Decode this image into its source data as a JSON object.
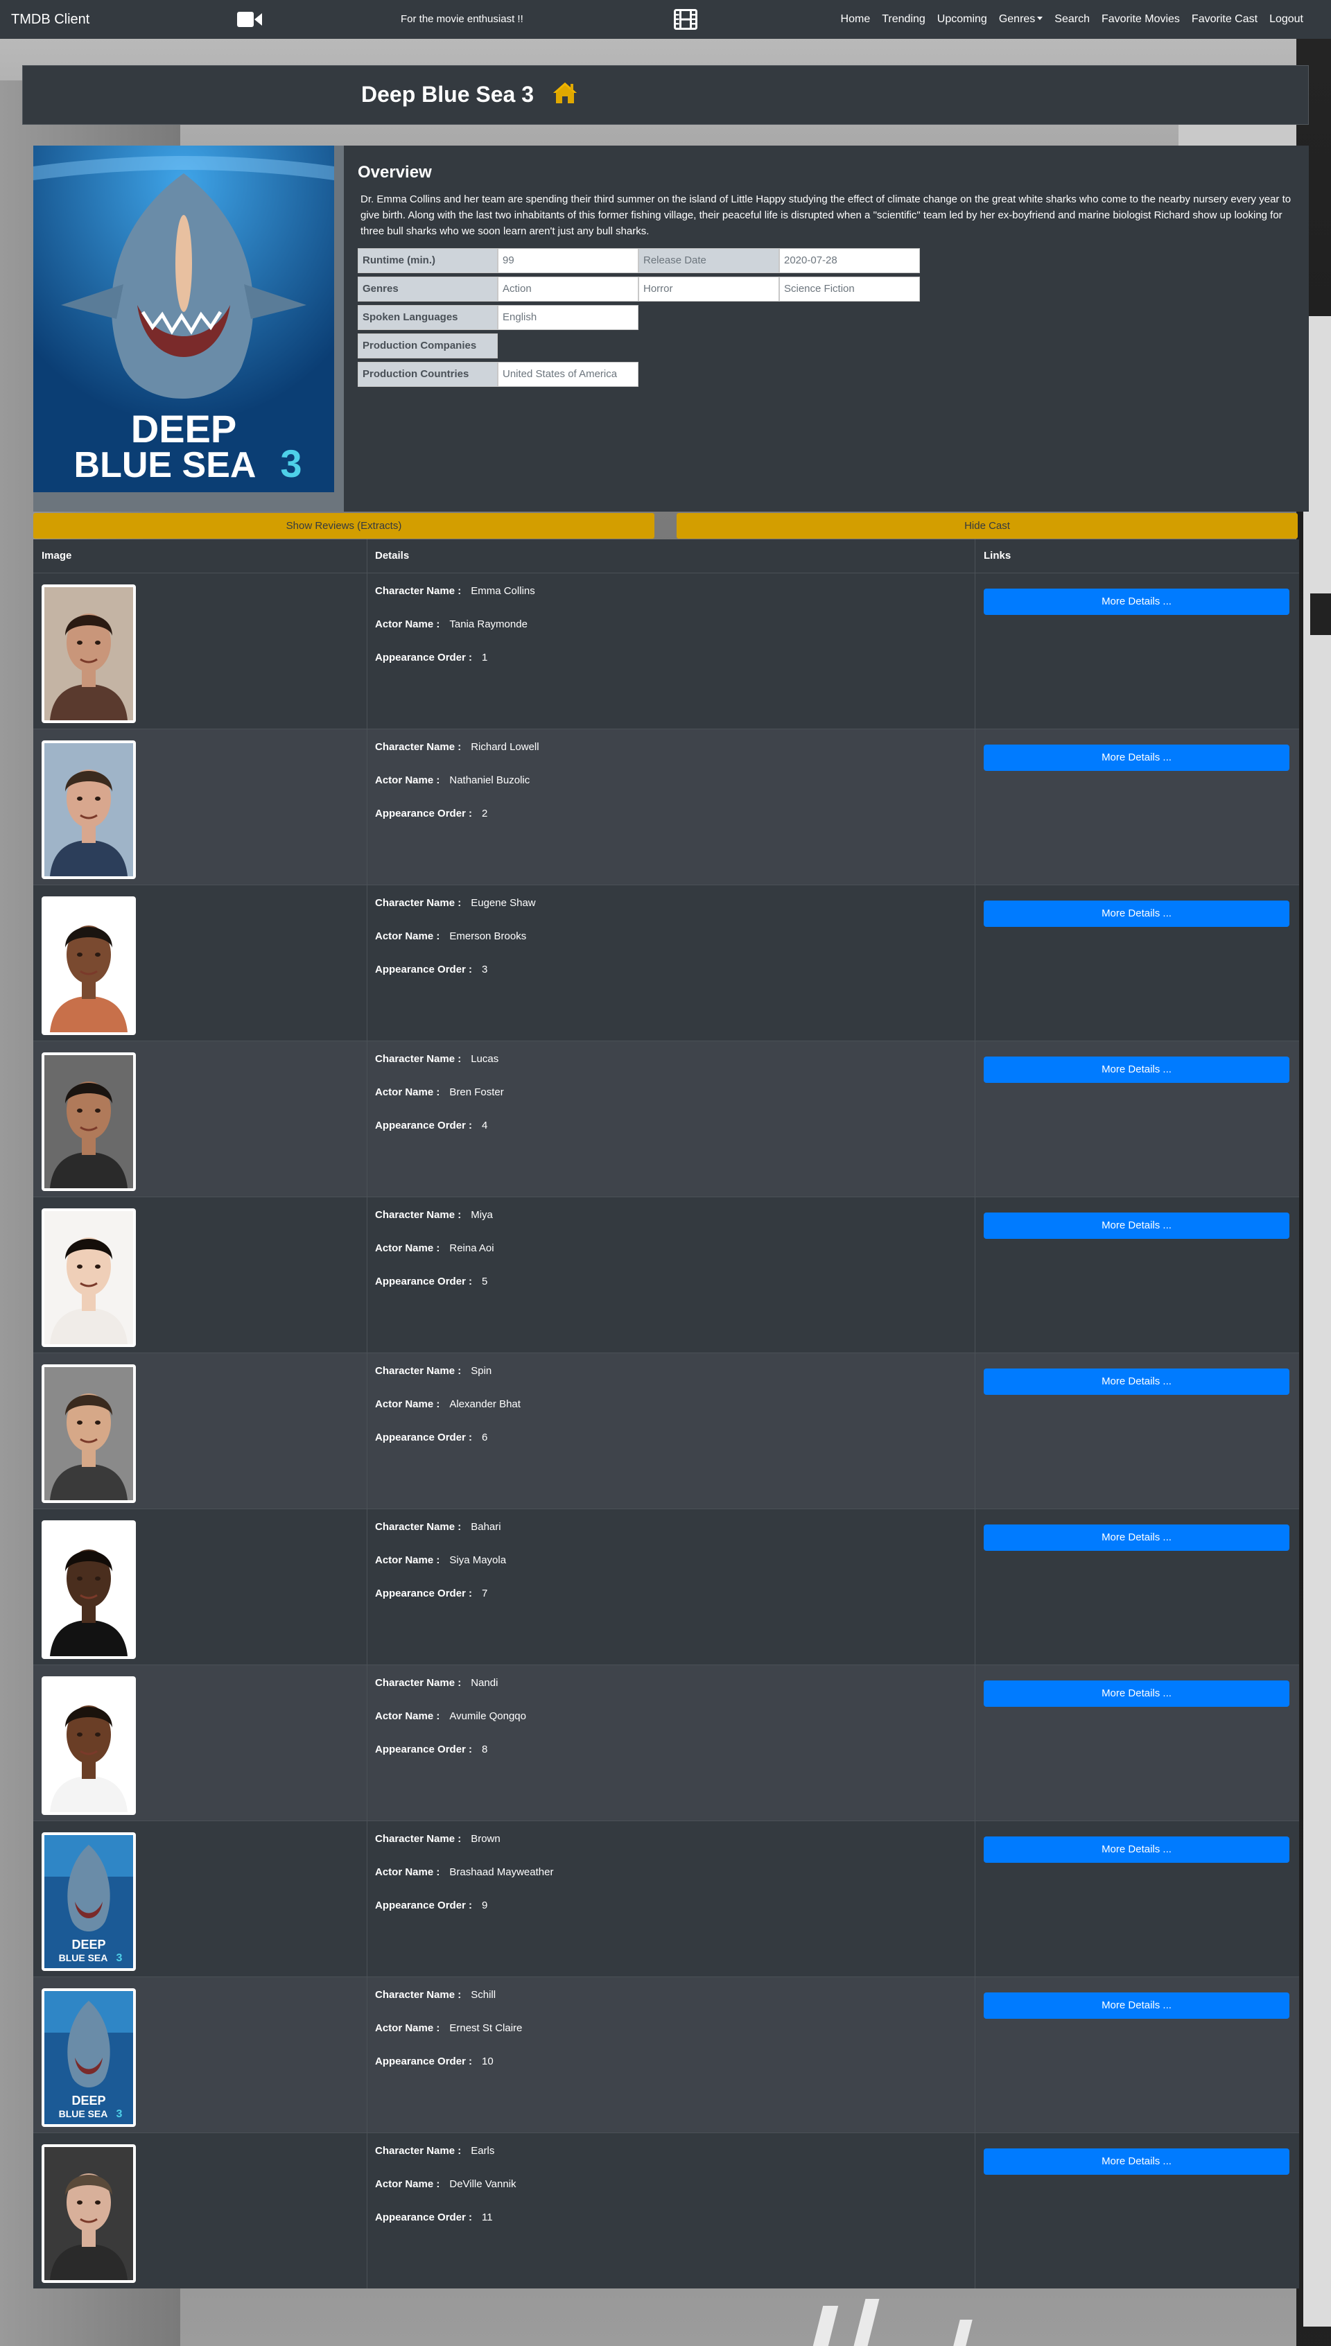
{
  "navbar": {
    "brand": "TMDB Client",
    "tagline": "For the movie enthusiast !!",
    "camera_icon": "video-camera-icon",
    "film_icon": "film-icon",
    "links": [
      "Home",
      "Trending",
      "Upcoming",
      "Genres",
      "Search",
      "Favorite Movies",
      "Favorite Cast",
      "Logout"
    ]
  },
  "movie": {
    "title": "Deep Blue Sea 3",
    "home_icon": "home-icon",
    "poster_text_line1": "DEEP",
    "poster_text_line2": "BLUE SEA",
    "poster_text_num": "3",
    "overview_heading": "Overview",
    "overview": "Dr. Emma Collins and her team are spending their third summer on the island of Little Happy studying the effect of climate change on the great white sharks who come to the nearby nursery every year to give birth. Along with the last two inhabitants of this former fishing village, their peaceful life is disrupted when a \"scientific\" team led by her ex-boyfriend and marine biologist Richard show up looking for three bull sharks who we soon learn aren't just any bull sharks.",
    "runtime_label": "Runtime (min.)",
    "runtime": "99",
    "release_label": "Release Date",
    "release_date": "2020-07-28",
    "genres_label": "Genres",
    "genres": [
      "Action",
      "Horror",
      "Science Fiction"
    ],
    "languages_label": "Spoken Languages",
    "languages": "English",
    "companies_label": "Production Companies",
    "countries_label": "Production Countries",
    "countries": "United States of America"
  },
  "buttons": {
    "show_reviews": "Show Reviews (Extracts)",
    "hide_cast": "Hide Cast",
    "more_details": "More Details ..."
  },
  "cast_table": {
    "headers": [
      "Image",
      "Details",
      "Links"
    ],
    "character_label": "Character Name :",
    "actor_label": "Actor Name :",
    "order_label": "Appearance Order :",
    "rows": [
      {
        "character": "Emma Collins",
        "actor": "Tania Raymonde",
        "order": "1",
        "photo": "woman-dark-hair",
        "skin": "#c9967a",
        "hair": "#2a1a12",
        "shirt": "#5a3a2e",
        "bg": "#c4b4a4"
      },
      {
        "character": "Richard Lowell",
        "actor": "Nathaniel Buzolic",
        "order": "2",
        "photo": "man-smiling",
        "skin": "#d8a78e",
        "hair": "#3a2a1e",
        "shirt": "#2c3e5a",
        "bg": "#9fb4c8"
      },
      {
        "character": "Eugene Shaw",
        "actor": "Emerson Brooks",
        "order": "3",
        "photo": "man-plaid-shirt",
        "skin": "#7a4a30",
        "hair": "#1a1410",
        "shirt": "#c8704a",
        "bg": "#ffffff"
      },
      {
        "character": "Lucas",
        "actor": "Bren Foster",
        "order": "4",
        "photo": "man-stubble",
        "skin": "#b07a5a",
        "hair": "#1a1410",
        "shirt": "#2a2a2a",
        "bg": "#6a6a6a"
      },
      {
        "character": "Miya",
        "actor": "Reina Aoi",
        "order": "5",
        "photo": "woman-smiling",
        "skin": "#efcfb8",
        "hair": "#140e0a",
        "shirt": "#f0ece8",
        "bg": "#f6f4f2"
      },
      {
        "character": "Spin",
        "actor": "Alexander Bhat",
        "order": "6",
        "photo": "man-portrait",
        "skin": "#d6a888",
        "hair": "#3a2a1e",
        "shirt": "#3a3a3a",
        "bg": "#8a8a8a"
      },
      {
        "character": "Bahari",
        "actor": "Siya Mayola",
        "order": "7",
        "photo": "man-suit",
        "skin": "#4a2e1e",
        "hair": "#120c08",
        "shirt": "#121212",
        "bg": "#ffffff"
      },
      {
        "character": "Nandi",
        "actor": "Avumile Qongqo",
        "order": "8",
        "photo": "woman-braids",
        "skin": "#6a3e26",
        "hair": "#1a120c",
        "shirt": "#f4f4f4",
        "bg": "#ffffff"
      },
      {
        "character": "Brown",
        "actor": "Brashaad Mayweather",
        "order": "9",
        "photo": "poster-placeholder",
        "skin": "",
        "hair": "",
        "shirt": "",
        "bg": ""
      },
      {
        "character": "Schill",
        "actor": "Ernest St Claire",
        "order": "10",
        "photo": "poster-placeholder",
        "skin": "",
        "hair": "",
        "shirt": "",
        "bg": ""
      },
      {
        "character": "Earls",
        "actor": "DeVille Vannik",
        "order": "11",
        "photo": "man-serious",
        "skin": "#d8b09a",
        "hair": "#5a4a3a",
        "shirt": "#2a2a2a",
        "bg": "#3a3a3a"
      }
    ]
  },
  "colors": {
    "navbar": "#343a40",
    "accent_yellow": "#d39e00",
    "primary_blue": "#007bff"
  }
}
